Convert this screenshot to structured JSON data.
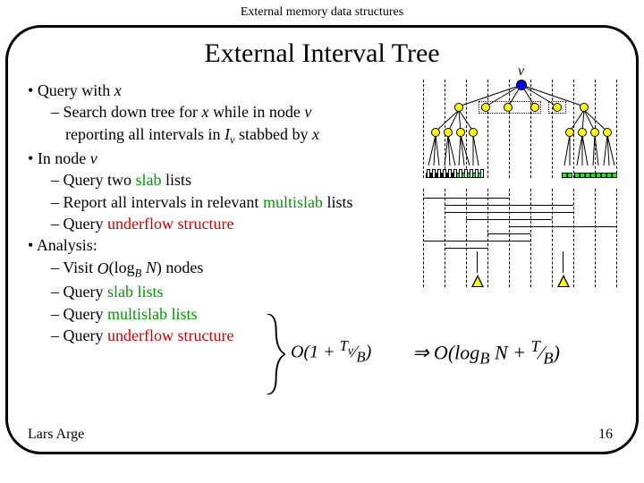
{
  "header": "External memory data structures",
  "title": "External Interval Tree",
  "lines": [
    {
      "lvl": 1,
      "html": "Query with <span class='italic'>x</span>"
    },
    {
      "lvl": 2,
      "html": "Search down tree for <span class='italic'>x</span> while in node <span class='italic'>v</span>"
    },
    {
      "lvl": 0,
      "html": "reporting all intervals in <span class='italic'>I<span class='sub'>v</span></span> stabbed by <span class='italic'>x</span>"
    },
    {
      "lvl": 1,
      "html": "In node <span class='italic'>v</span>"
    },
    {
      "lvl": 2,
      "html": "Query two <span class='green'>slab</span> lists"
    },
    {
      "lvl": 2,
      "html": "Report all intervals in relevant <span class='green'>multislab</span> lists"
    },
    {
      "lvl": 2,
      "html": "Query <span class='red'>underflow structure</span>"
    },
    {
      "lvl": 1,
      "html": "Analysis:"
    },
    {
      "lvl": 2,
      "html": "Visit <span class='math-img'>O</span>(log<span class='sub'>B</span> <span class='italic'>N</span>) nodes"
    },
    {
      "lvl": 2,
      "html": "Query <span class='green'>slab lists</span>"
    },
    {
      "lvl": 2,
      "html": "Query <span class='green'>multislab lists</span>"
    },
    {
      "lvl": 2,
      "html": "Query <span class='red'>underflow structure</span>"
    }
  ],
  "formula_mid": "O(1 + <sup>T<sub>v</sub></sup>&frasl;<sub>B</sub>)",
  "formula_right": "&rArr; O(log<sub>B</sub> N + <sup>T</sup>&frasl;<sub>B</sub>)",
  "tree_root_label": "v",
  "footer_left": "Lars Arge",
  "footer_right": "16"
}
